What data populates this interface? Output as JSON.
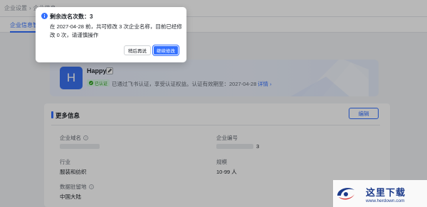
{
  "breadcrumb": {
    "items": [
      "企业设置",
      "企业信息"
    ]
  },
  "tabs": [
    {
      "label": "企业信息管理"
    }
  ],
  "org": {
    "avatar_letter": "H",
    "name": "Happy",
    "verified_badge": "已认证",
    "verify_desc": "已通过飞书认证，享受认证权益。认证有效期至：2027-04-28",
    "detail_link": "详情 ›"
  },
  "more_info": {
    "title": "更多信息",
    "edit_label": "编辑",
    "fields": {
      "domain_label": "企业域名",
      "code_label": "企业编号",
      "code_value_suffix": "3",
      "industry_label": "行业",
      "industry_value": "服装和纺织",
      "scale_label": "规模",
      "scale_value": "10-99 人",
      "data_location_label": "数据驻留地",
      "data_location_value": "中国大陆"
    }
  },
  "popover": {
    "title": "剩余改名次数：3",
    "body": "在 2027-04-28 前，共可修改 3 次企业名称，目前已经修改 0 次，请谨慎操作",
    "later_label": "稍后再说",
    "continue_label": "继续修改"
  },
  "watermark": {
    "text_cn": "这里下载",
    "url": "www.herdown.com"
  },
  "colors": {
    "primary": "#3370ff",
    "verified": "#2ea121",
    "watermark": "#1b3a8a"
  }
}
